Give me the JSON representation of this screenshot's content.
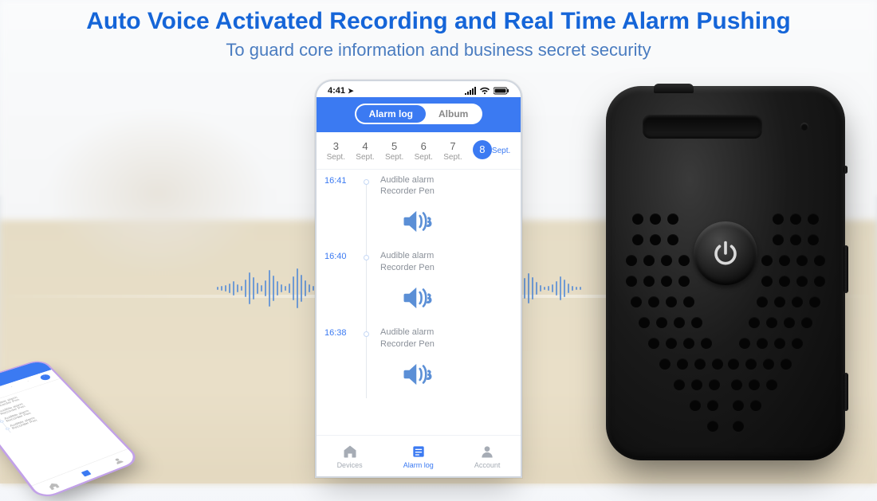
{
  "colors": {
    "accent": "#3b7af2",
    "title": "#1565d8",
    "subtitle": "#4a7cc0"
  },
  "headings": {
    "title": "Auto Voice Activated Recording and Real Time Alarm Pushing",
    "subtitle": "To guard core information and business secret security"
  },
  "phone": {
    "status": {
      "time": "4:41",
      "location_arrow": "➤"
    },
    "tabs": {
      "active": "Alarm log",
      "inactive": "Album"
    },
    "dates": [
      {
        "day": "3",
        "month": "Sept.",
        "active": false
      },
      {
        "day": "4",
        "month": "Sept.",
        "active": false
      },
      {
        "day": "5",
        "month": "Sept.",
        "active": false
      },
      {
        "day": "6",
        "month": "Sept.",
        "active": false
      },
      {
        "day": "7",
        "month": "Sept.",
        "active": false
      },
      {
        "day": "8",
        "month": "Sept.",
        "active": true
      }
    ],
    "logs": [
      {
        "time": "16:41",
        "line1": "Audible alarm",
        "line2": "Recorder Pen"
      },
      {
        "time": "16:40",
        "line1": "Audible alarm",
        "line2": "Recorder Pen"
      },
      {
        "time": "16:38",
        "line1": "Audible alarm",
        "line2": "Recorder Pen"
      }
    ],
    "nav": [
      {
        "label": "Devices",
        "active": false
      },
      {
        "label": "Alarm log",
        "active": true
      },
      {
        "label": "Account",
        "active": false
      }
    ]
  },
  "device": {
    "button": "power"
  }
}
